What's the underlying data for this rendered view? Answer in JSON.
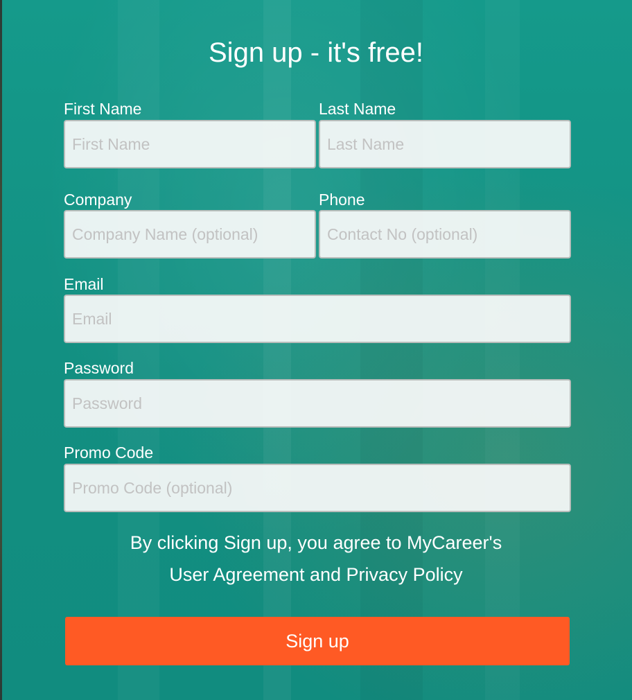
{
  "form": {
    "title": "Sign up - it's free!",
    "first_name": {
      "label": "First Name",
      "placeholder": "First Name",
      "value": ""
    },
    "last_name": {
      "label": "Last Name",
      "placeholder": "Last Name",
      "value": ""
    },
    "company": {
      "label": "Company",
      "placeholder": "Company Name (optional)",
      "value": ""
    },
    "phone": {
      "label": "Phone",
      "placeholder": "Contact No (optional)",
      "value": ""
    },
    "email": {
      "label": "Email",
      "placeholder": "Email",
      "value": ""
    },
    "password": {
      "label": "Password",
      "placeholder": "Password",
      "value": ""
    },
    "promo": {
      "label": "Promo Code",
      "placeholder": "Promo Code (optional)",
      "value": ""
    },
    "agreement_line1": "By clicking Sign up, you agree to MyCareer's",
    "agreement_line2": "User Agreement and Privacy Policy",
    "submit_label": "Sign up"
  },
  "colors": {
    "panel_teal": "#129585",
    "button_orange": "#ff5a24",
    "text_white": "#ffffff",
    "placeholder_grey": "#c2c2c2"
  }
}
